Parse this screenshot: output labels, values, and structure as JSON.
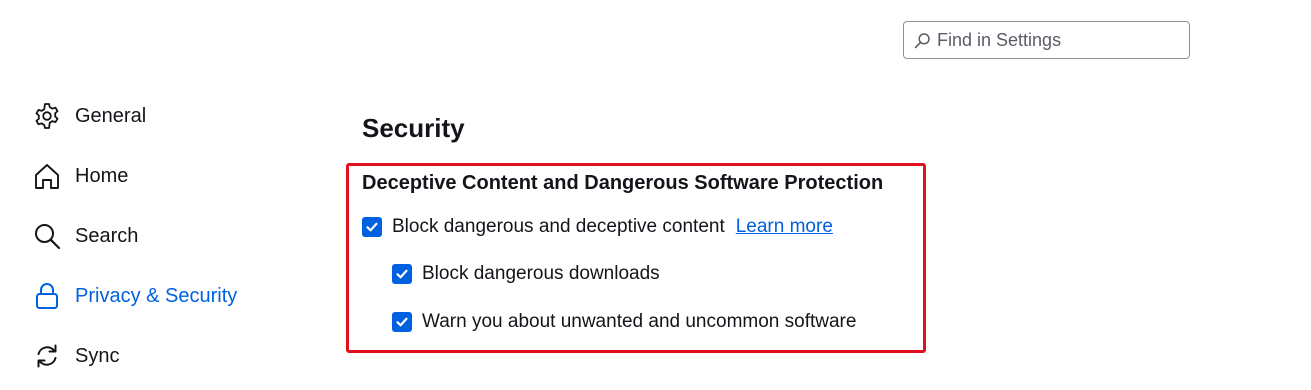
{
  "search": {
    "placeholder": "Find in Settings",
    "value": ""
  },
  "sidebar": {
    "items": [
      {
        "label": "General",
        "icon": "gear-icon"
      },
      {
        "label": "Home",
        "icon": "home-icon"
      },
      {
        "label": "Search",
        "icon": "search-icon"
      },
      {
        "label": "Privacy & Security",
        "icon": "lock-icon",
        "active": true
      },
      {
        "label": "Sync",
        "icon": "sync-icon"
      }
    ]
  },
  "main": {
    "section_title": "Security",
    "group": {
      "title": "Deceptive Content and Dangerous Software Protection",
      "options": [
        {
          "label": "Block dangerous and deceptive content",
          "checked": true,
          "link": "Learn more"
        },
        {
          "label": "Block dangerous downloads",
          "checked": true
        },
        {
          "label": "Warn you about unwanted and uncommon software",
          "checked": true
        }
      ]
    }
  },
  "colors": {
    "accent": "#0061e0",
    "highlight": "#e0101e",
    "text": "#15141a"
  }
}
